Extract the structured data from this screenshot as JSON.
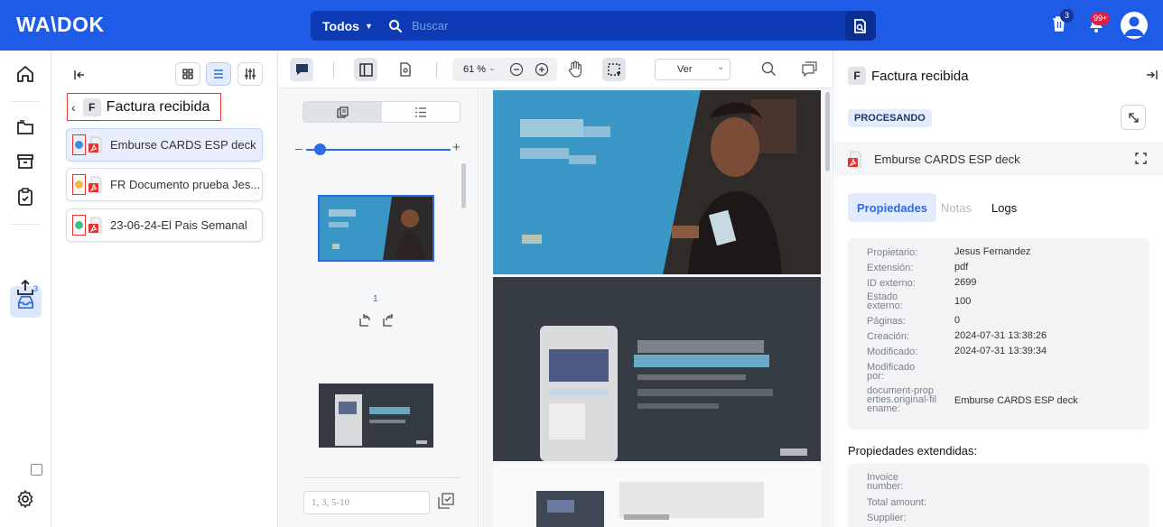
{
  "app": {
    "logo": "WA\\DOK"
  },
  "search": {
    "scope": "Todos",
    "placeholder": "Buscar"
  },
  "topbar": {
    "trash_badge": "3",
    "notif_badge": "99+"
  },
  "nav": {
    "inbox_badge": "3"
  },
  "folder": {
    "badge": "F",
    "title": "Factura recibida"
  },
  "documents": [
    {
      "title": "Emburse CARDS ESP deck",
      "status_color": "#3b8fd8"
    },
    {
      "title": "FR Documento prueba Jes...",
      "status_color": "#f5b83d"
    },
    {
      "title": "23-06-24-El Pais Semanal",
      "status_color": "#3fbf85"
    }
  ],
  "thumbnails": {
    "page_label": "1",
    "range_placeholder": "1, 3, 5-10"
  },
  "toolbar": {
    "zoom": "61 %",
    "view_select": "Ver"
  },
  "detail": {
    "badge": "F",
    "title": "Factura recibida",
    "status": "PROCESANDO",
    "document_name": "Emburse CARDS ESP deck",
    "tabs": {
      "properties": "Propiedades",
      "notes": "Notas",
      "logs": "Logs"
    },
    "properties": [
      {
        "label": "Propietario:",
        "value": "Jesus Fernandez"
      },
      {
        "label": "Extensión:",
        "value": "pdf"
      },
      {
        "label": "ID externo:",
        "value": "2699"
      },
      {
        "label": "Estado externo:",
        "value": "100"
      },
      {
        "label": "Páginas:",
        "value": "0"
      },
      {
        "label": "Creación:",
        "value": "2024-07-31 13:38:26"
      },
      {
        "label": "Modificado:",
        "value": "2024-07-31 13:39:34"
      },
      {
        "label": "Modificado por:",
        "value": ""
      },
      {
        "label": "document-properties.original-filename:",
        "value": "Emburse CARDS ESP deck"
      }
    ],
    "extended_title": "Propiedades extendidas:",
    "extended": [
      {
        "label": "Invoice number:"
      },
      {
        "label": "Total amount:"
      },
      {
        "label": "Supplier:"
      }
    ]
  },
  "colors": {
    "brand": "#1e5ce8",
    "search_bg": "#0c3bb5",
    "accent": "#2b6be6",
    "status_bg": "#e3ebfc"
  }
}
